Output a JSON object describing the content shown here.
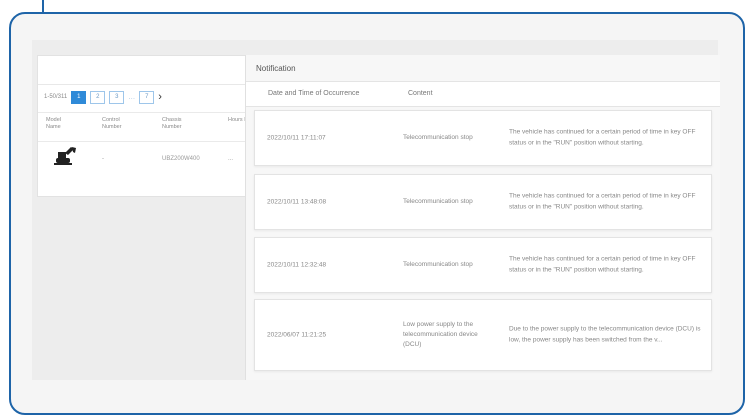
{
  "notification": {
    "title": "Notification",
    "columns": {
      "date": "Date and Time of Occurrence",
      "content": "Content"
    },
    "rows": [
      {
        "date": "2022/10/11 17:11:07",
        "type": "Telecommunication stop",
        "description": "The vehicle has continued for a certain period of time in key OFF status or in the \"RUN\" position without starting."
      },
      {
        "date": "2022/10/11 13:48:08",
        "type": "Telecommunication stop",
        "description": "The vehicle has continued for a certain period of time in key OFF status or in the \"RUN\" position without starting."
      },
      {
        "date": "2022/10/11 12:32:48",
        "type": "Telecommunication stop",
        "description": "The vehicle has continued for a certain period of time in key OFF status or in the \"RUN\" position without starting."
      },
      {
        "date": "2022/06/07 11:21:25",
        "type": "Low power supply to the telecommunication device (DCU)",
        "description": "Due to the power supply to the telecommunication device (DCU) is low, the power supply has been switched from the v..."
      }
    ]
  },
  "list": {
    "range": "1-50/311",
    "pages": [
      "1",
      "2",
      "3",
      "…",
      "7"
    ],
    "next": "›",
    "last": "›|",
    "columns": [
      "Model Name",
      "Control Number",
      "Chassis Number",
      "Hours Meter"
    ],
    "row": {
      "control": "-",
      "chassis": "UBZ200W400",
      "hours": "..."
    }
  },
  "icons": {
    "machine": "excavator-icon"
  },
  "colors": {
    "frame": "#1e64a8",
    "accent": "#2f8ad8"
  }
}
